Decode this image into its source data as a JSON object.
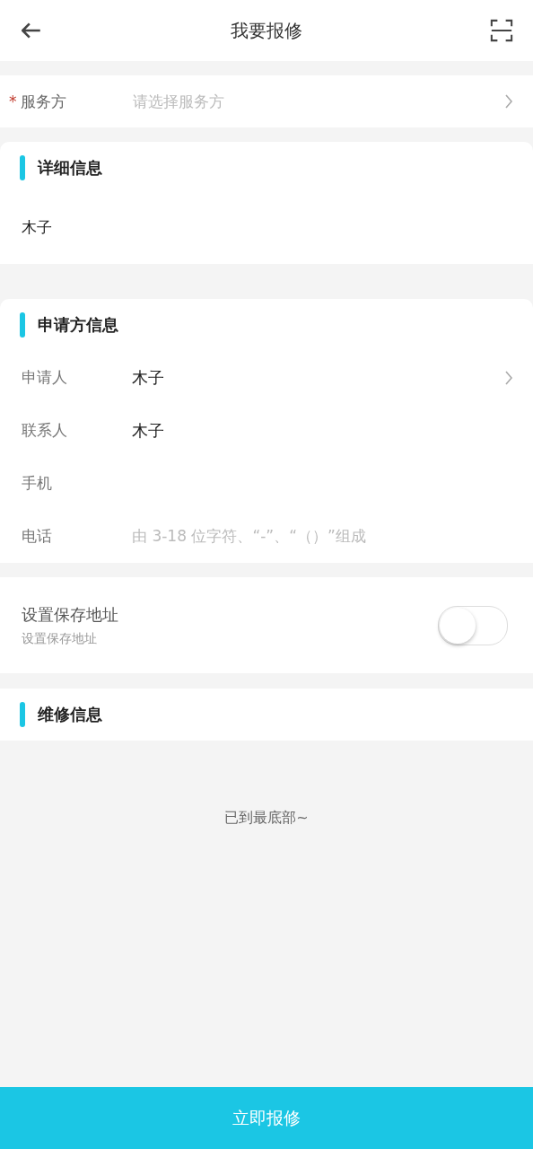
{
  "header": {
    "title": "我要报修"
  },
  "service_row": {
    "required_mark": "*",
    "label": "服务方",
    "placeholder": "请选择服务方",
    "chevron": true
  },
  "details": {
    "title": "详细信息",
    "value": "木子"
  },
  "applicant": {
    "title": "申请方信息",
    "rows": [
      {
        "label": "申请人",
        "value": "木子",
        "chevron": true
      },
      {
        "label": "联系人",
        "value": "木子",
        "chevron": false
      },
      {
        "label": "手机",
        "chevron": false
      },
      {
        "label": "电话",
        "placeholder": "由 3-18 位字符、“-”、“（）”组成",
        "chevron": false
      }
    ]
  },
  "save_address": {
    "title": "设置保存地址",
    "subtitle": "设置保存地址",
    "on": false
  },
  "repair": {
    "title": "维修信息"
  },
  "end_note": "已到最底部~",
  "submit_button": "立即报修"
}
